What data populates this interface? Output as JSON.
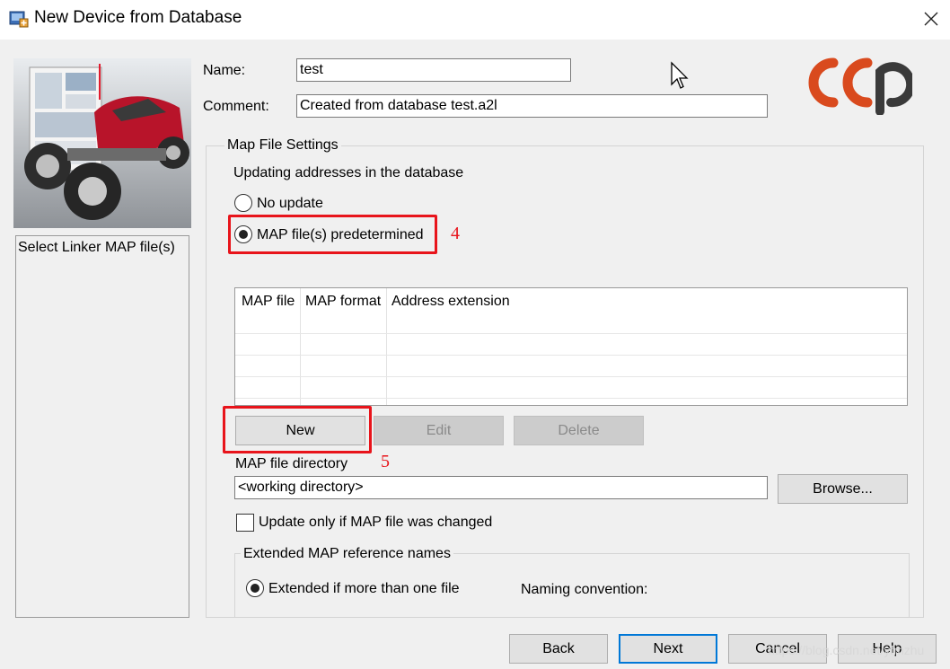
{
  "window": {
    "title": "New Device from Database"
  },
  "side_panel": {
    "label": "Select Linker MAP file(s)"
  },
  "form": {
    "name_label": "Name:",
    "name_value": "test",
    "comment_label": "Comment:",
    "comment_value": "Created from database test.a2l"
  },
  "logo": {
    "text": "ccp"
  },
  "map_settings": {
    "group_title": "Map File Settings",
    "updating_label": "Updating addresses in the database",
    "radio_no_update": "No update",
    "radio_predetermined": "MAP file(s) predetermined",
    "selected_radio": "predetermined",
    "table": {
      "columns": [
        "MAP file",
        "MAP format",
        "Address extension"
      ],
      "rows": []
    },
    "buttons": {
      "new": "New",
      "edit": "Edit",
      "delete": "Delete"
    },
    "directory_label": "MAP file directory",
    "directory_value": "<working directory>",
    "browse_label": "Browse...",
    "update_only_label": "Update only if MAP file was changed",
    "update_only_checked": false,
    "extended": {
      "group_title": "Extended MAP reference names",
      "radio_label": "Extended if more than one file",
      "naming_label": "Naming convention:"
    }
  },
  "annotations": {
    "a4": "4",
    "a5": "5"
  },
  "footer": {
    "back": "Back",
    "next": "Next",
    "cancel": "Cancel",
    "help": "Help"
  },
  "watermark": "https://blog.csdn.net/yfmzhu",
  "colors": {
    "annotation_red": "#e8141b",
    "focus_blue": "#0078d7",
    "logo_red": "#d94a1e",
    "logo_dark": "#3a3a3a"
  }
}
